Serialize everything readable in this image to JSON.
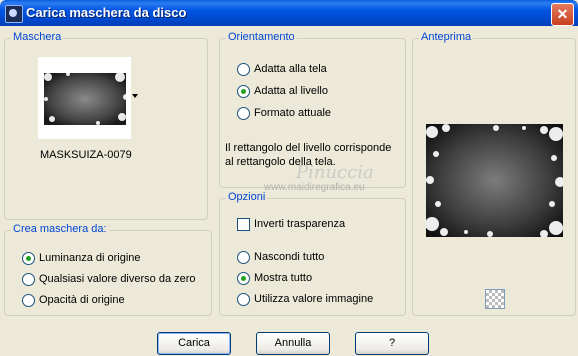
{
  "window": {
    "title": "Carica maschera da disco",
    "close_label": "✕"
  },
  "maschera": {
    "legend": "Maschera",
    "mask_name": "MASKSUIZA-0079"
  },
  "crea": {
    "legend": "Crea maschera da:",
    "options": [
      "Luminanza di origine",
      "Qualsiasi valore diverso da zero",
      "Opacità di origine"
    ],
    "selected_index": 0
  },
  "orientamento": {
    "legend": "Orientamento",
    "options": [
      "Adatta alla tela",
      "Adatta al livello",
      "Formato attuale"
    ],
    "selected_index": 1,
    "description": [
      "Il rettangolo del livello corrisponde",
      "al rettangolo della tela."
    ]
  },
  "opzioni": {
    "legend": "Opzioni",
    "invert_label": "Inverti trasparenza",
    "invert_checked": false,
    "options": [
      "Nascondi tutto",
      "Mostra tutto",
      "Utilizza valore immagine"
    ],
    "selected_index": 1
  },
  "anteprima": {
    "legend": "Anteprima"
  },
  "watermark": {
    "line1": "Pinuccia",
    "line2": "www.maidiregrafica.eu"
  },
  "buttons": {
    "load": "Carica",
    "cancel": "Annulla",
    "help": "?"
  }
}
